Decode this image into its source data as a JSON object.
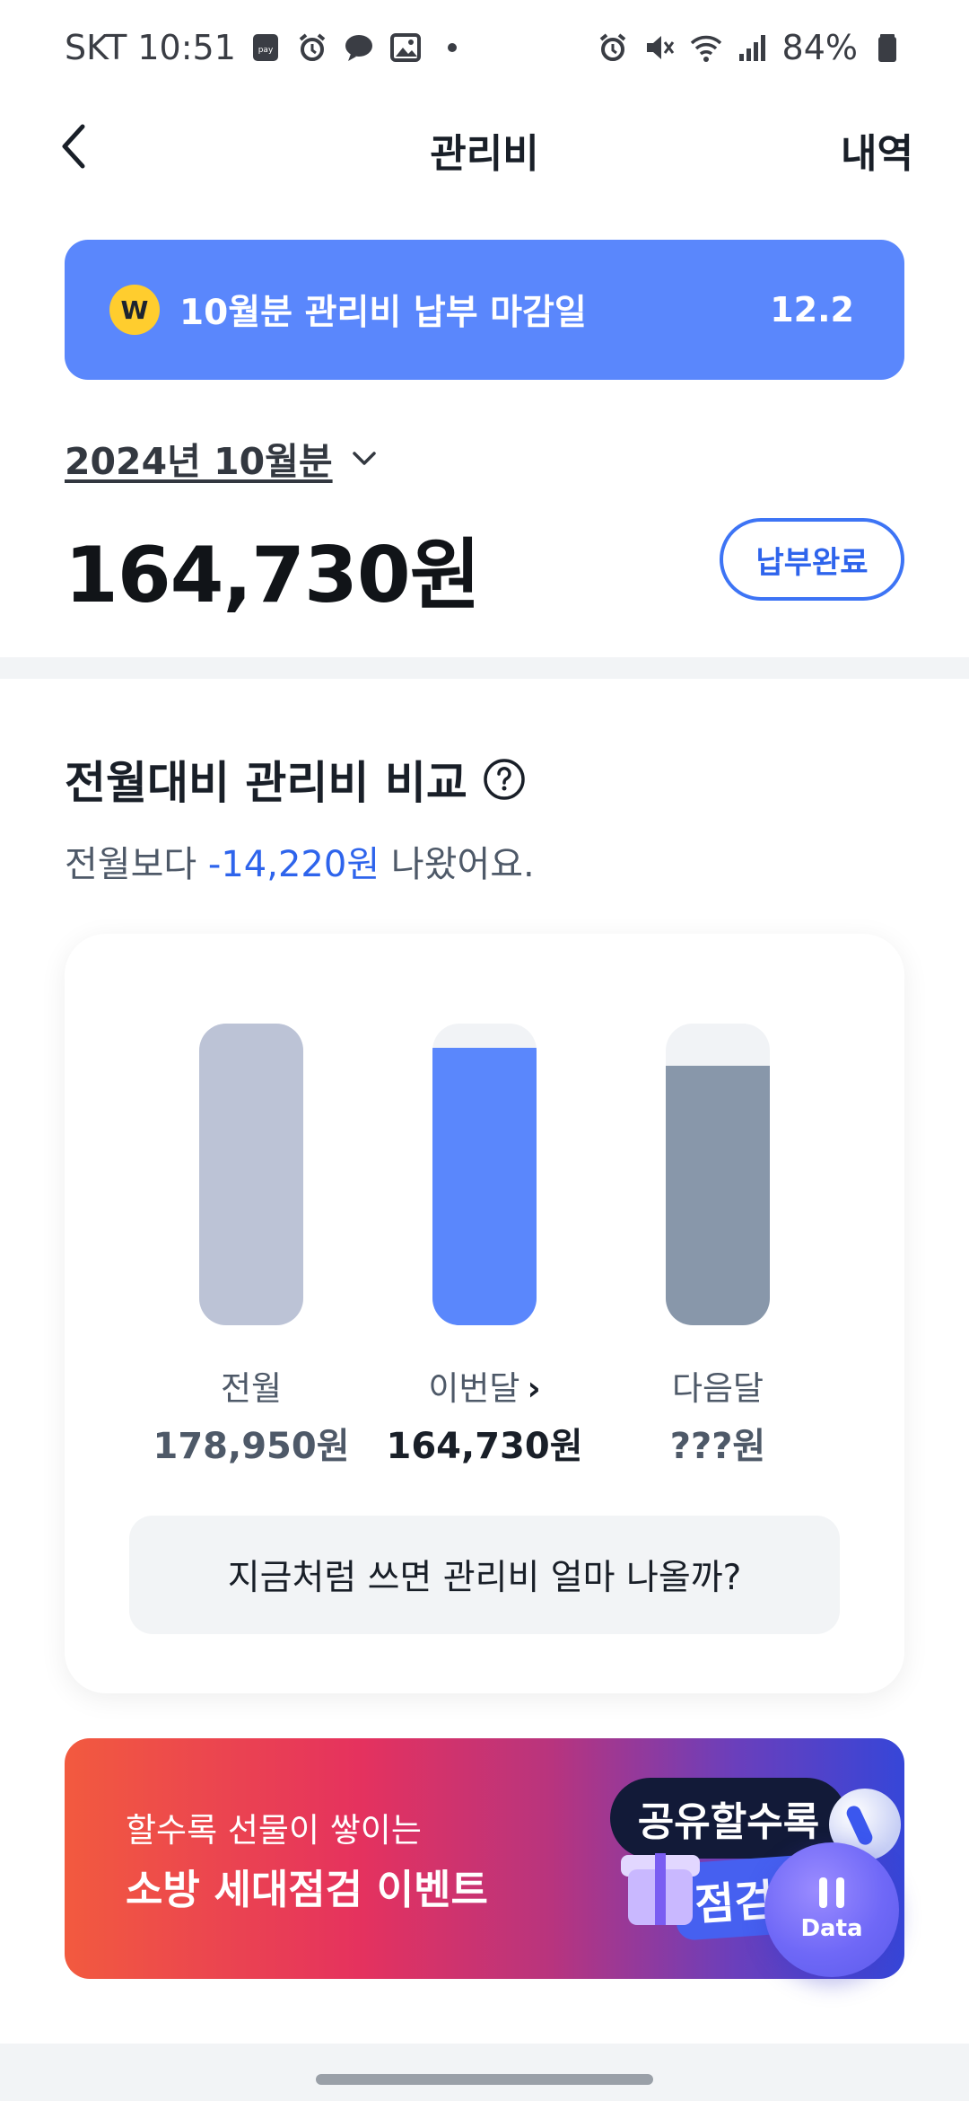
{
  "status_bar": {
    "carrier_time": "SKT 10:51",
    "battery": "84%",
    "left_icons": [
      "pay-icon",
      "alarm-icon",
      "chat-icon",
      "gallery-icon",
      "dot-icon"
    ],
    "right_icons": [
      "alarm-icon",
      "mute-icon",
      "wifi-icon",
      "signal-icon",
      "battery-icon"
    ]
  },
  "header": {
    "title": "관리비",
    "history_label": "내역"
  },
  "due_banner": {
    "coin_symbol": "W",
    "text": "10월분 관리비 납부 마감일",
    "date": "12.2",
    "color": "#5a87fc"
  },
  "bill": {
    "period": "2024년 10월분",
    "amount": "164,730원",
    "status": "납부완료"
  },
  "comparison": {
    "title": "전월대비 관리비 비교",
    "sentence_prefix": "전월보다",
    "diff": "-14,220원",
    "sentence_suffix": "나왔어요.",
    "predict_button": "지금처럼 쓰면 관리비 얼마 나올까?"
  },
  "chart_data": {
    "type": "bar",
    "categories": [
      "전월",
      "이번달",
      "다음달"
    ],
    "value_labels": [
      "178,950원",
      "164,730원",
      "???원"
    ],
    "fill_fraction": [
      1.0,
      0.92,
      0.86
    ],
    "colors": [
      "#bcc3d6",
      "#5a87fc",
      "#8897aa"
    ],
    "track_color": "#f1f3f6"
  },
  "event": {
    "subtitle": "할수록 선물이 쌓이는",
    "title": "소방 세대점검 이벤트",
    "pill_dark": "공유할수록",
    "pill_blue": "점검할"
  },
  "fab": {
    "label": "Data"
  }
}
